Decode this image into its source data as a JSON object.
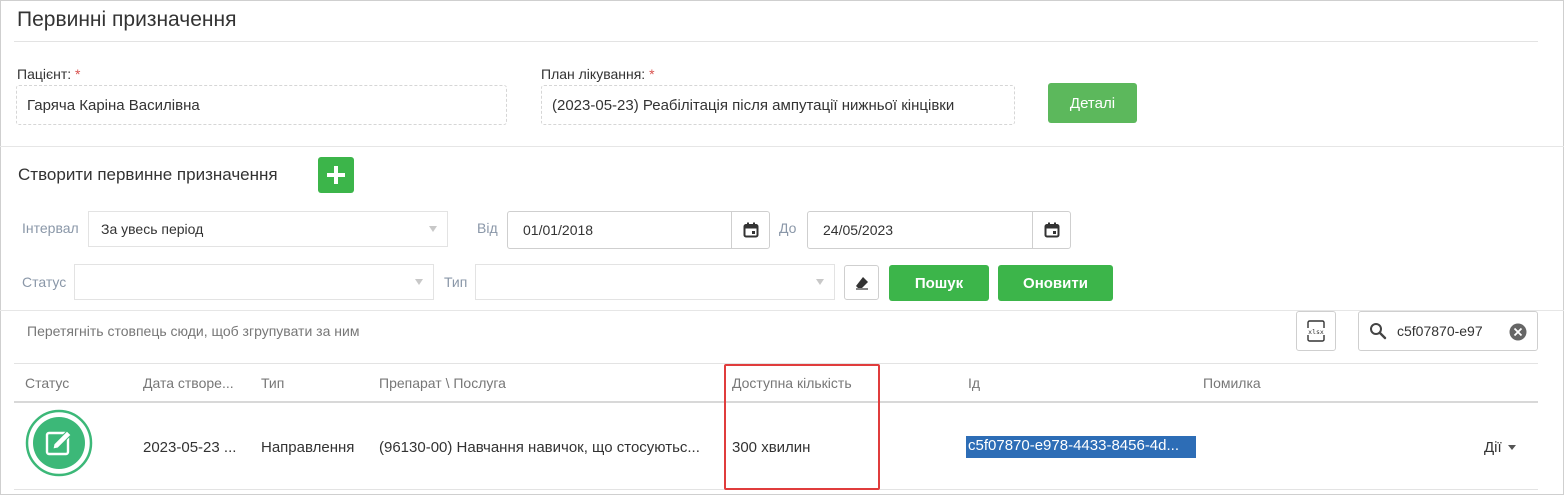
{
  "page": {
    "title": "Первинні призначення"
  },
  "patient": {
    "label": "Пацієнт:",
    "required_mark": "*",
    "value": "Гаряча Каріна Василівна"
  },
  "plan": {
    "label": "План лікування:",
    "required_mark": "*",
    "value": "(2023-05-23) Реабілітація після ампутації нижньої кінцівки"
  },
  "details_button": "Деталі",
  "create": {
    "title": "Створити первинне призначення",
    "add_icon": "plus-icon"
  },
  "filters": {
    "interval_label": "Інтервал",
    "interval_value": "За увесь період",
    "from_label": "Від",
    "from_value": "01/01/2018",
    "to_label": "До",
    "to_value": "24/05/2023",
    "status_label": "Статус",
    "status_value": "",
    "type_label": "Тип",
    "type_value": "",
    "search_button": "Пошук",
    "refresh_button": "Оновити"
  },
  "grid": {
    "group_hint": "Перетягніть стовпець сюди, щоб згрупувати за ним",
    "export_label": "xlsx",
    "search_value": "c5f07870-e97",
    "columns": [
      "Статус",
      "Дата створе...",
      "Тип",
      "Препарат \\ Послуга",
      "Доступна кількість",
      "Ід",
      "Помилка"
    ],
    "rows": [
      {
        "status_icon": "edit-icon",
        "created": "2023-05-23 ...",
        "type": "Направлення",
        "service": "(96130-00) Навчання навичок, що стосуютьс...",
        "available": "300 хвилин",
        "id": "c5f07870-e978-4433-8456-4d...",
        "error": "",
        "actions": "Дії"
      }
    ]
  },
  "colors": {
    "green": "#5cb85c",
    "green_dark": "#3cb54a",
    "highlight": "#e03c3c",
    "selection": "#2d6db6"
  }
}
